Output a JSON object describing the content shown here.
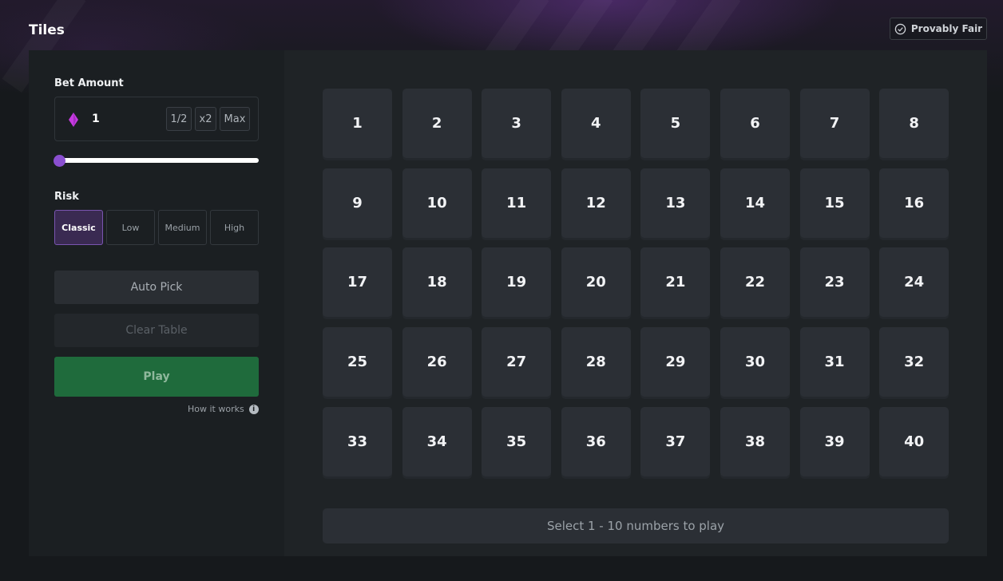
{
  "header": {
    "title": "Tiles",
    "provably_fair_label": "Provably Fair"
  },
  "sidebar": {
    "bet_label": "Bet Amount",
    "bet_value": "1",
    "half_label": "1/2",
    "double_label": "x2",
    "max_label": "Max",
    "slider_fraction": 0,
    "risk_label": "Risk",
    "risk_options": [
      "Classic",
      "Low",
      "Medium",
      "High"
    ],
    "risk_selected": "Classic",
    "auto_pick_label": "Auto Pick",
    "clear_table_label": "Clear Table",
    "play_label": "Play",
    "how_it_works_label": "How it works"
  },
  "board": {
    "tiles": [
      "1",
      "2",
      "3",
      "4",
      "5",
      "6",
      "7",
      "8",
      "9",
      "10",
      "11",
      "12",
      "13",
      "14",
      "15",
      "16",
      "17",
      "18",
      "19",
      "20",
      "21",
      "22",
      "23",
      "24",
      "25",
      "26",
      "27",
      "28",
      "29",
      "30",
      "31",
      "32",
      "33",
      "34",
      "35",
      "36",
      "37",
      "38",
      "39",
      "40"
    ],
    "status_text": "Select 1 - 10 numbers to play"
  },
  "colors": {
    "accent": "#8a4fd0",
    "gem": "#c63be0",
    "play_button": "#1f6b3c",
    "tile": "#2b2f35"
  },
  "icons": {
    "fair": "check-circle-icon",
    "currency": "diamond-gem-icon",
    "info": "info-icon"
  }
}
